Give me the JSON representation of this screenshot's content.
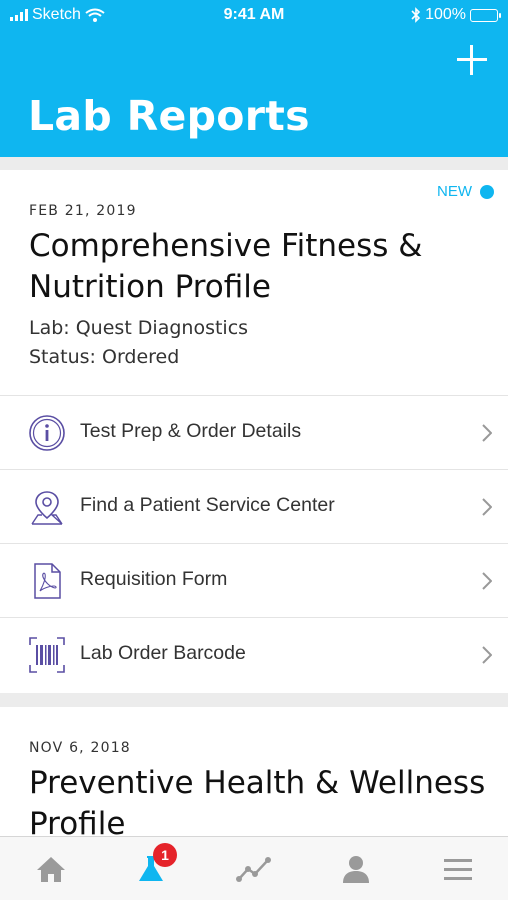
{
  "status_bar": {
    "carrier": "Sketch",
    "time": "9:41 AM",
    "battery": "100%"
  },
  "header": {
    "title": "Lab Reports",
    "add_icon": "plus-icon"
  },
  "reports": [
    {
      "badge": "NEW",
      "date": "FEB 21, 2019",
      "title": "Comprehensive Fitness & Nutrition Profile",
      "lab": "Lab: Quest Diagnostics",
      "status": "Status: Ordered",
      "actions": [
        {
          "label": "Test Prep & Order Details",
          "icon": "info-icon"
        },
        {
          "label": "Find a Patient Service Center",
          "icon": "map-pin-icon"
        },
        {
          "label": "Requisition Form",
          "icon": "pdf-document-icon"
        },
        {
          "label": "Lab Order Barcode",
          "icon": "barcode-icon"
        }
      ]
    },
    {
      "date": "NOV 6, 2018",
      "title": "Preventive Health & Wellness Profile"
    }
  ],
  "tab_bar": {
    "tabs": [
      "home-icon",
      "lab-flask-icon",
      "trends-icon",
      "profile-icon",
      "menu-icon"
    ],
    "badge_count": "1",
    "active_color": "#0fb6f0",
    "inactive_color": "#9a9a9a"
  },
  "colors": {
    "brand": "#0fb6f0",
    "icon_purple": "#5a4ea3",
    "badge_red": "#e5232a"
  }
}
